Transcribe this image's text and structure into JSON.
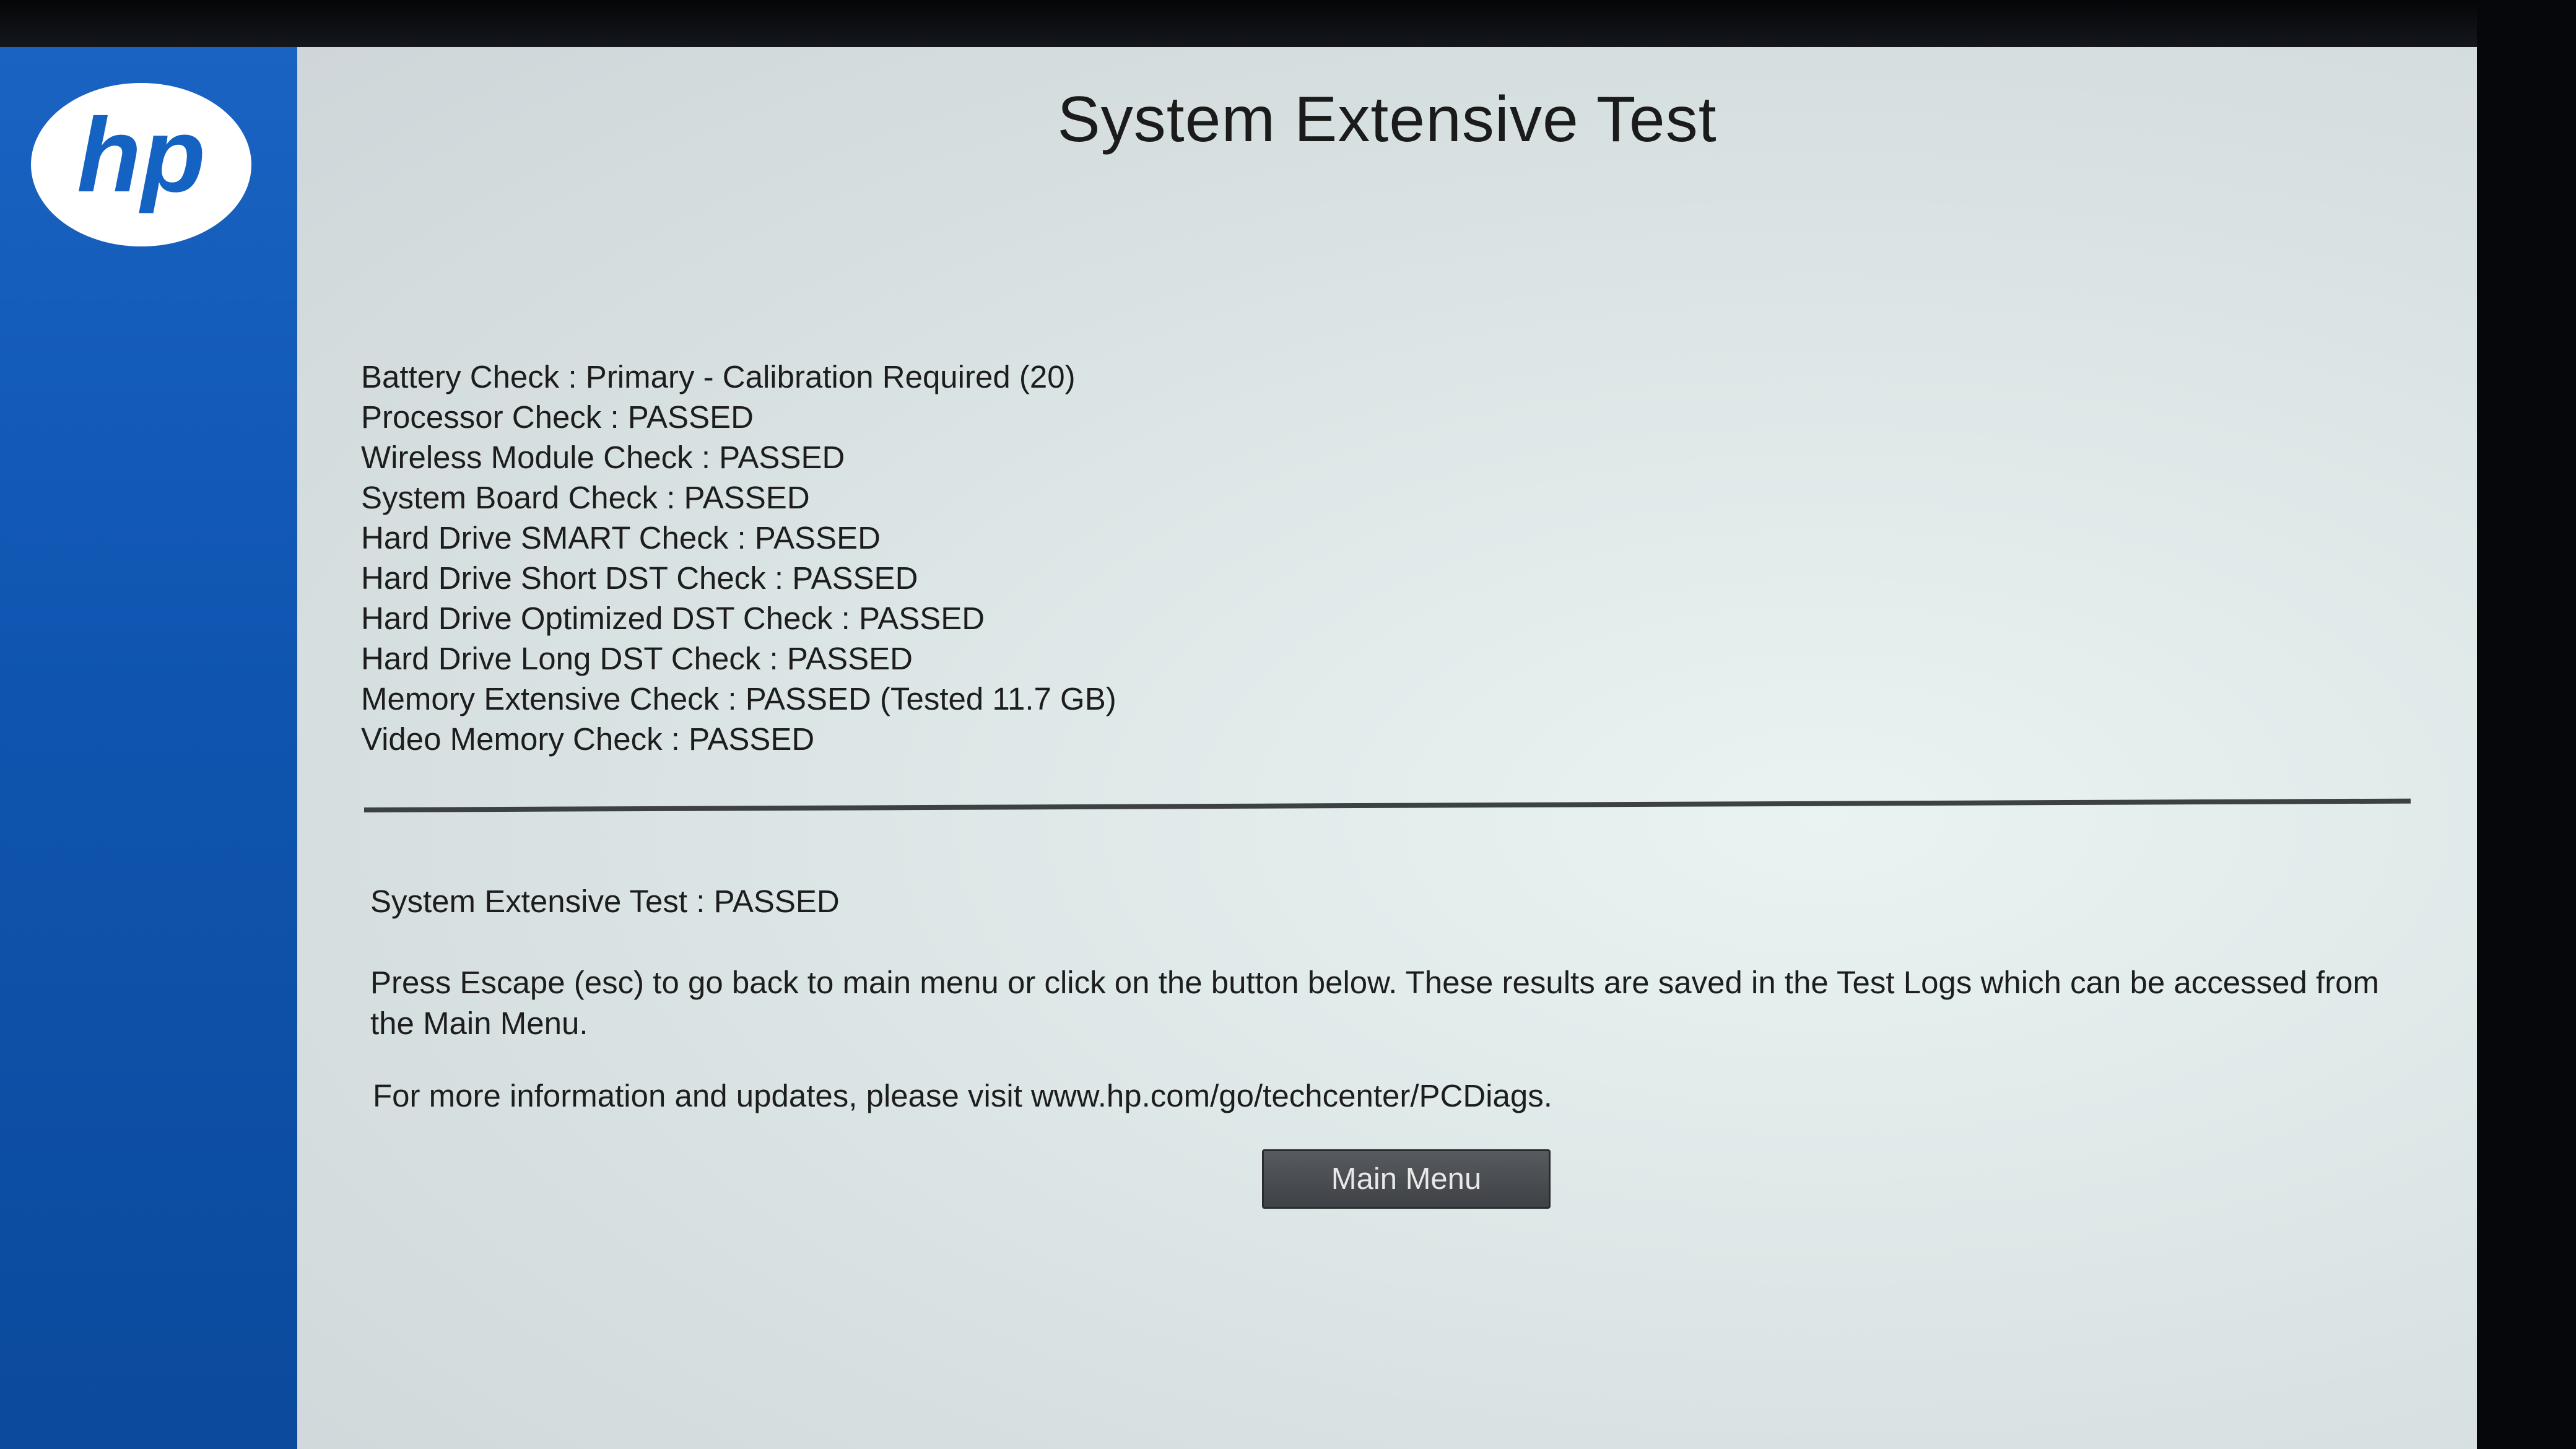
{
  "sidebar": {
    "logo_text": "hp",
    "brand_color": "#1463c3"
  },
  "header": {
    "title": "System Extensive Test"
  },
  "checks": [
    "Battery Check : Primary - Calibration Required (20)",
    "Processor Check : PASSED",
    "Wireless Module Check : PASSED",
    "System Board Check : PASSED",
    "Hard Drive SMART Check : PASSED",
    "Hard Drive Short DST Check : PASSED",
    "Hard Drive Optimized DST Check : PASSED",
    "Hard Drive Long DST Check : PASSED",
    "Memory Extensive Check : PASSED (Tested 11.7 GB)",
    "Video Memory Check : PASSED"
  ],
  "summary": "System Extensive Test : PASSED",
  "instructions": "Press Escape (esc) to go back to main menu or click on the button below. These results are saved in the Test Logs which can be accessed from the Main Menu.",
  "info": "For more information and updates, please visit www.hp.com/go/techcenter/PCDiags.",
  "buttons": {
    "main_menu": "Main Menu"
  }
}
